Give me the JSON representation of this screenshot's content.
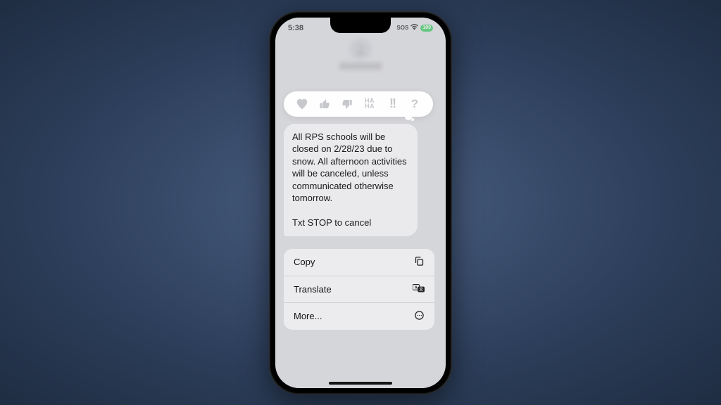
{
  "status": {
    "time": "5:38",
    "sos": "SOS",
    "battery": "100"
  },
  "reactions": {
    "heart": "♥",
    "thumbs_up": "👍",
    "thumbs_down": "👎",
    "haha": "HA\nHA",
    "exclaim": "!!",
    "question": "?"
  },
  "message": {
    "body": "All RPS schools will be closed on 2/28/23 due to snow.  All afternoon activities will be canceled, unless communicated otherwise tomorrow.\n\nTxt STOP to cancel"
  },
  "menu": {
    "copy": "Copy",
    "translate": "Translate",
    "more": "More..."
  }
}
